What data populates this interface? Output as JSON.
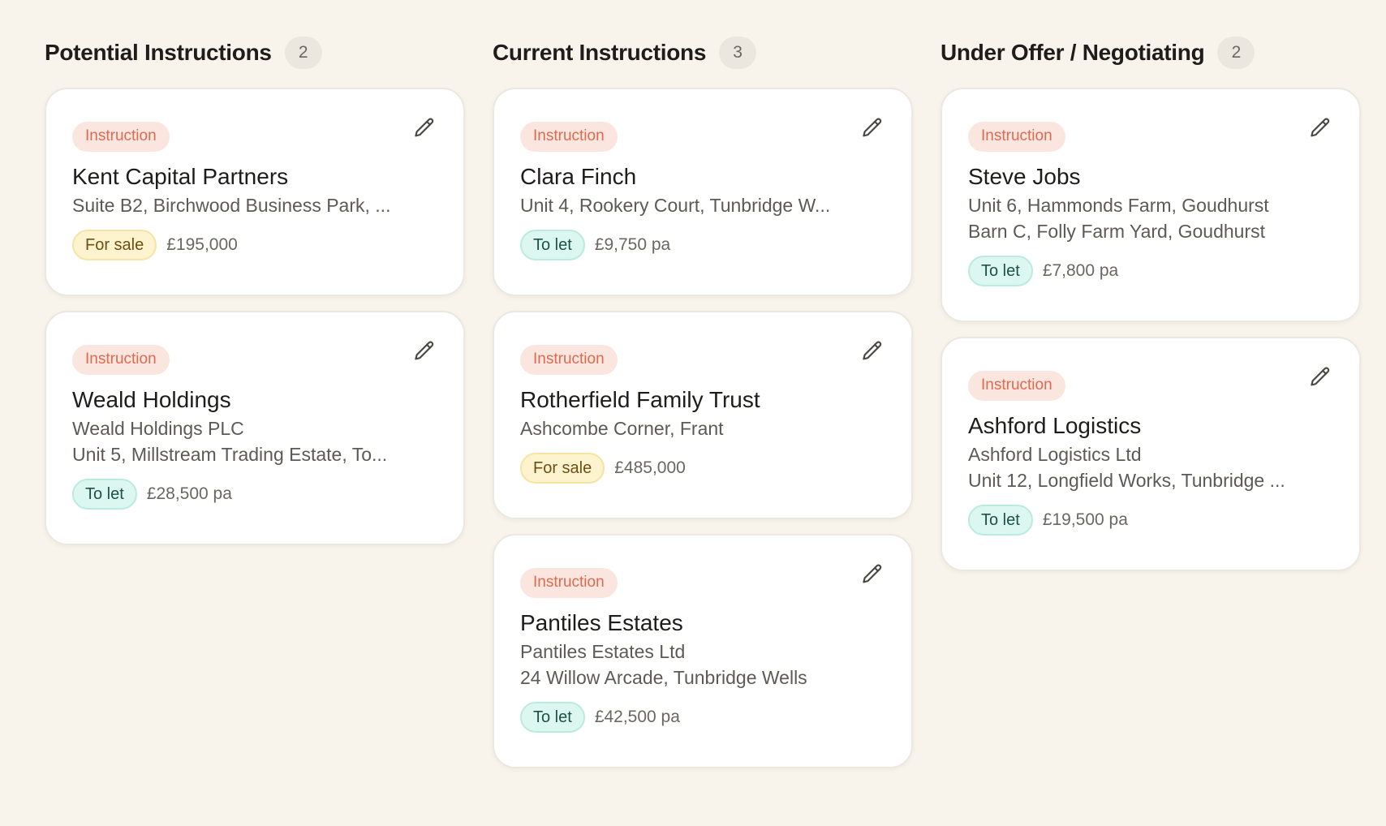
{
  "columns": [
    {
      "title": "Potential Instructions",
      "count": "2",
      "cards": [
        {
          "tag": "Instruction",
          "name": "Kent Capital Partners",
          "lines": [
            "Suite B2, Birchwood Business Park, ..."
          ],
          "status": "For sale",
          "status_type": "sale",
          "price": "£195,000"
        },
        {
          "tag": "Instruction",
          "name": "Weald Holdings",
          "lines": [
            "Weald Holdings PLC",
            "Unit 5, Millstream Trading Estate, To..."
          ],
          "status": "To let",
          "status_type": "let",
          "price": "£28,500 pa"
        }
      ]
    },
    {
      "title": "Current Instructions",
      "count": "3",
      "cards": [
        {
          "tag": "Instruction",
          "name": "Clara Finch",
          "lines": [
            "Unit 4, Rookery Court, Tunbridge W..."
          ],
          "status": "To let",
          "status_type": "let",
          "price": "£9,750 pa"
        },
        {
          "tag": "Instruction",
          "name": "Rotherfield Family Trust",
          "lines": [
            "Ashcombe Corner, Frant"
          ],
          "status": "For sale",
          "status_type": "sale",
          "price": "£485,000"
        },
        {
          "tag": "Instruction",
          "name": "Pantiles Estates",
          "lines": [
            "Pantiles Estates Ltd",
            "24 Willow Arcade, Tunbridge Wells"
          ],
          "status": "To let",
          "status_type": "let",
          "price": "£42,500 pa"
        }
      ]
    },
    {
      "title": "Under Offer / Negotiating",
      "count": "2",
      "cards": [
        {
          "tag": "Instruction",
          "name": "Steve Jobs",
          "lines": [
            "Unit 6, Hammonds Farm, Goudhurst",
            "Barn C, Folly Farm Yard, Goudhurst"
          ],
          "status": "To let",
          "status_type": "let",
          "price": "£7,800 pa"
        },
        {
          "tag": "Instruction",
          "name": "Ashford Logistics",
          "lines": [
            "Ashford Logistics Ltd",
            "Unit 12, Longfield Works, Tunbridge ..."
          ],
          "status": "To let",
          "status_type": "let",
          "price": "£19,500 pa"
        }
      ]
    }
  ],
  "icons": {
    "edit": "pencil-icon"
  },
  "colors": {
    "background": "#f8f4ec",
    "instruction_tag": "#dd6a4e",
    "for_sale": "#fdf3cf",
    "to_let": "#dbf7ef"
  }
}
